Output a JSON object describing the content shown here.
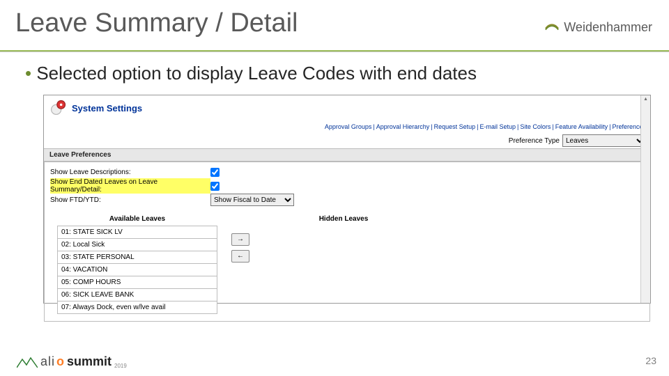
{
  "slide": {
    "title": "Leave Summary / Detail",
    "bullet_1": "Selected option to display Leave Codes with end dates",
    "page_number": "23"
  },
  "brand": {
    "name": "Weidenhammer"
  },
  "footer": {
    "logo_part1": "ali",
    "logo_o": "o",
    "logo_part2": "summit",
    "year": "2019"
  },
  "screenshot": {
    "header": "System Settings",
    "top_links": [
      "Approval Groups",
      "Approval Hierarchy",
      "Request Setup",
      "E-mail Setup",
      "Site Colors",
      "Feature Availability",
      "Preferences"
    ],
    "preference_type_label": "Preference Type",
    "preference_type_value": "Leaves",
    "section_bar": "Leave Preferences",
    "rows": {
      "show_leave_descriptions": {
        "label": "Show Leave Descriptions:",
        "checked": true
      },
      "show_end_dated": {
        "label": "Show End Dated Leaves on Leave Summary/Detail:",
        "checked": true
      },
      "show_ftd_ytd": {
        "label": "Show FTD/YTD:",
        "value": "Show Fiscal to Date"
      }
    },
    "available_title": "Available Leaves",
    "hidden_title": "Hidden Leaves",
    "available_leaves": [
      "01: STATE SICK LV",
      "02: Local Sick",
      "03: STATE PERSONAL",
      "04: VACATION",
      "05: COMP HOURS",
      "06: SICK LEAVE BANK",
      "07: Always Dock, even w/lve avail"
    ],
    "arrows": {
      "right": "→",
      "left": "←"
    }
  }
}
